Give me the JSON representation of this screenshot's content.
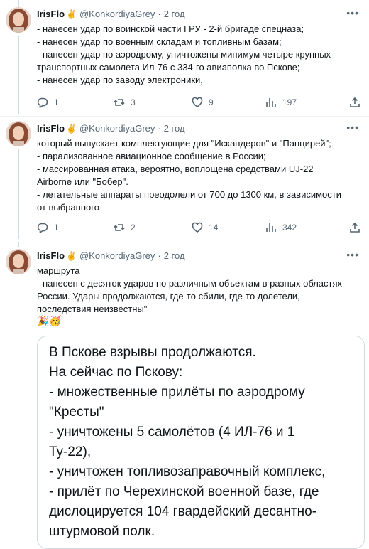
{
  "tweets": [
    {
      "name": "IrisFlo",
      "badge_emoji": "✌️",
      "handle": "@KonkordiyaGrey",
      "time": "2 год",
      "lines": [
        "- нанесен удар по воинской части ГРУ - 2-й бригаде спецназа;",
        "- нанесен удар по военным складам и топливным базам;",
        "- нанесен удар по аэродрому, уничтожены минимум четыре крупных",
        "транспортных самолета Ил-76 с 334-го авиаполка во Пскове;",
        "- нанесен удар по заводу электроники,"
      ],
      "replies": "1",
      "retweets": "3",
      "likes": "9",
      "views": "197"
    },
    {
      "name": "IrisFlo",
      "badge_emoji": "✌️",
      "handle": "@KonkordiyaGrey",
      "time": "2 год",
      "lines": [
        "который выпускает комплектующие для \"Искандеров\" и \"Панцирей\";",
        "- парализованное авиационное сообщение в России;",
        "- массированная атака, вероятно, воплощена средствами UJ-22",
        "Airborne или \"Бобер\".",
        "- летательные аппараты преодолели от 700 до 1300 км, в зависимости",
        "от выбранного"
      ],
      "replies": "1",
      "retweets": "2",
      "likes": "14",
      "views": "342"
    },
    {
      "name": "IrisFlo",
      "badge_emoji": "✌️",
      "handle": "@KonkordiyaGrey",
      "time": "2 год",
      "lines": [
        "маршрута",
        "- нанесен с десяток ударов по различным объектам в разных областях",
        "России. Удары продолжаются, где-то сбили, где-то долетели,",
        "последствия неизвестны\""
      ],
      "emoji_line": "🎉🥳"
    }
  ],
  "quote": {
    "lines": [
      "В Пскове взрывы продолжаются.",
      "На сейчас по Пскову:",
      "- множественные прилёты по аэродрому",
      "\"Кресты\"",
      "- уничтожены 5 самолётов (4 ИЛ-76 и 1",
      "Ту-22),",
      "- уничтожен топливозаправочный комплекс,",
      "- прилёт по Черехинской военной базе, где",
      "дислоцируется 104 гвардейский десантно-",
      "штурмовой полк."
    ]
  },
  "icons": {
    "more": "more-horizontal-icon",
    "reply": "reply-icon",
    "retweet": "retweet-icon",
    "like": "heart-icon",
    "views": "views-chart-icon",
    "share": "share-icon"
  },
  "colors": {
    "text": "#0f1419",
    "secondary": "#536471",
    "divider": "#eff3f4",
    "border": "#cfd9de"
  }
}
